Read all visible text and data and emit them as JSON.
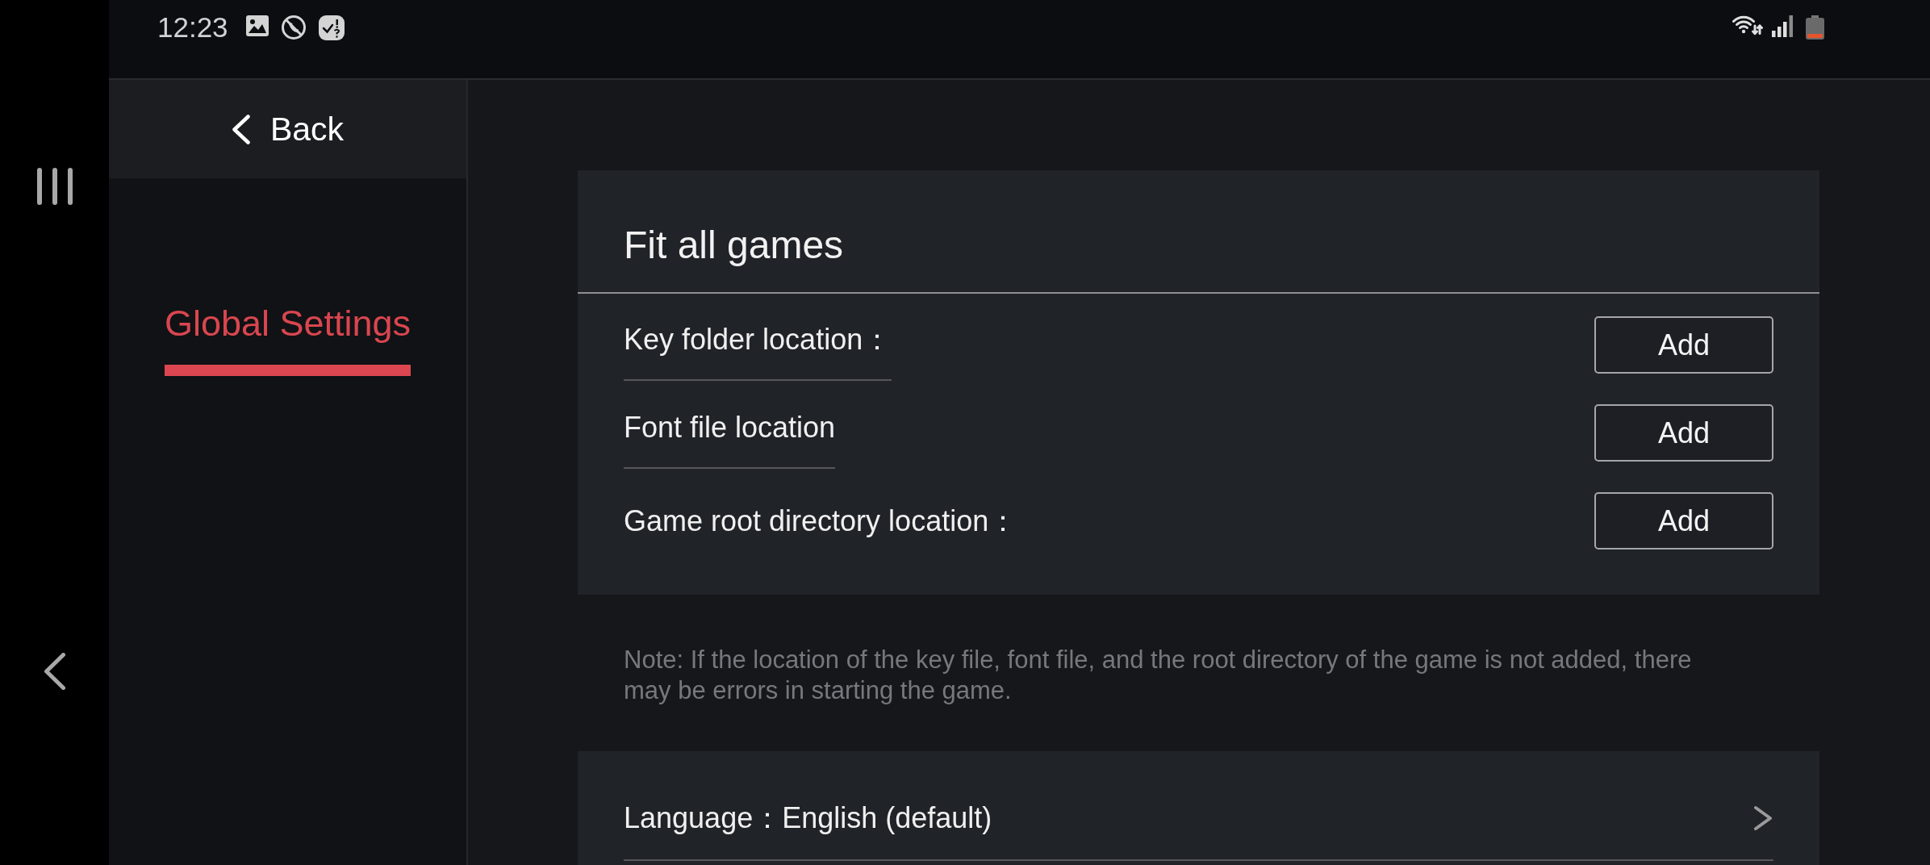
{
  "status_bar": {
    "time": "12:23"
  },
  "sidebar": {
    "back_button": {
      "label": "Back"
    },
    "items": [
      {
        "label": "Global Settings",
        "selected": true
      }
    ]
  },
  "card": {
    "title": "Fit all games",
    "rows": [
      {
        "label": "Key folder location：",
        "underlined": true,
        "button": "Add"
      },
      {
        "label": "Font file location",
        "underlined": true,
        "button": "Add"
      },
      {
        "label": "Game root directory location：",
        "underlined": false,
        "button": "Add"
      }
    ]
  },
  "note": "Note: If the location of the key file, font file, and the root directory of the game is not added, there may be errors in starting the game.",
  "settings": [
    {
      "label": "Language：",
      "value": "English (default)"
    }
  ]
}
